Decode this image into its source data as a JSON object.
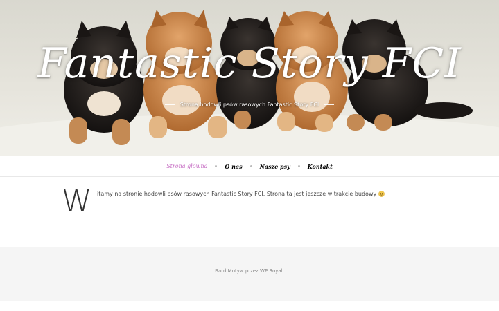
{
  "header": {
    "site_title": "Fantastic Story FCI",
    "tagline": "Strona hodowli psów rasowych Fantastic Story FCI"
  },
  "nav": {
    "items": [
      {
        "label": "Strona główna",
        "active": true
      },
      {
        "label": "O nas",
        "active": false
      },
      {
        "label": "Nasze psy",
        "active": false
      },
      {
        "label": "Kontakt",
        "active": false
      }
    ]
  },
  "content": {
    "dropcap": "W",
    "text": "itamy na stronie hodowli psów rasowych Fantastic Story FCI. Strona ta jest jeszcze w trakcie budowy",
    "emoji": "smile-icon"
  },
  "footer": {
    "credit": "Bard Motyw przez WP Royal."
  },
  "colors": {
    "nav_active": "#c76fc4",
    "footer_bg": "#f5f5f5",
    "emoji": "#f2c94c"
  },
  "hero_image": "five-shiba-inu-puppies-photo"
}
